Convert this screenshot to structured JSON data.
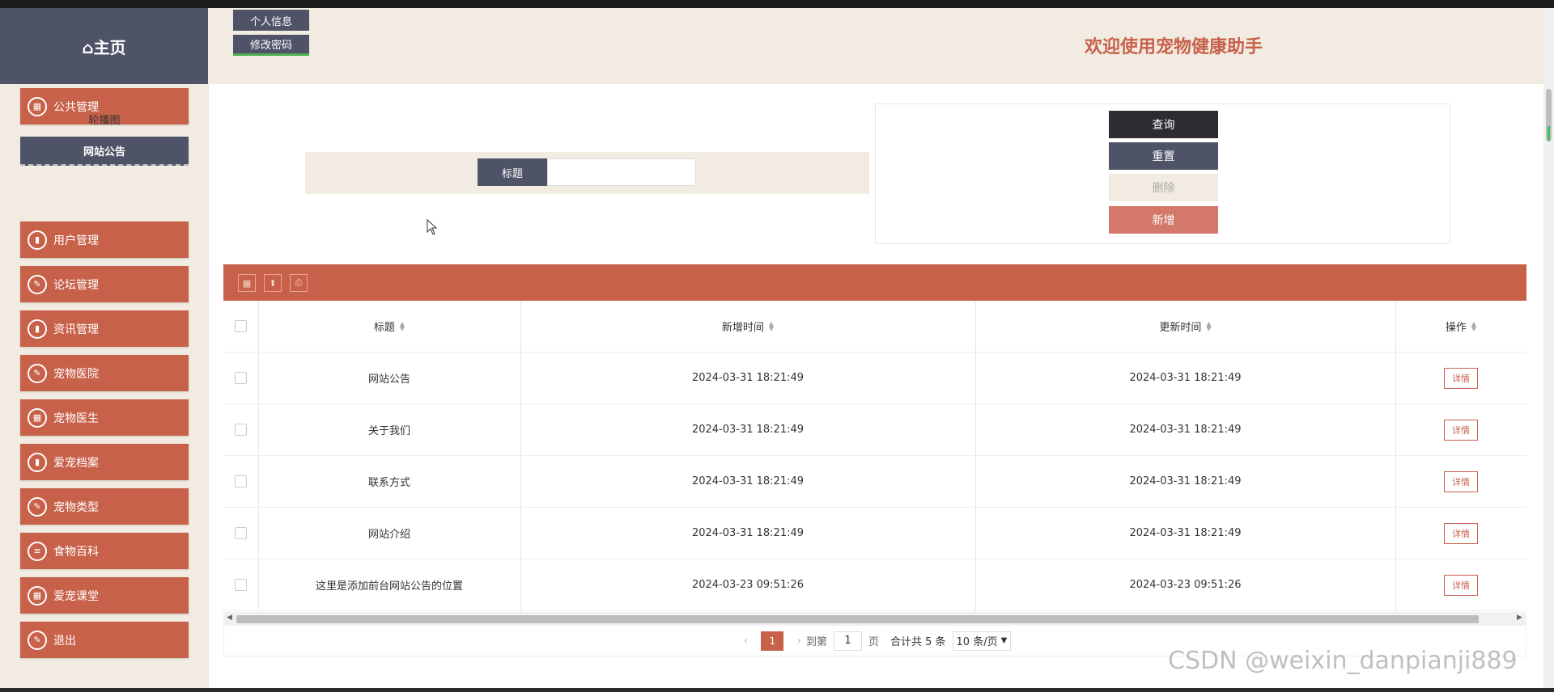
{
  "sidebar": {
    "logo": "⌂主页",
    "items": [
      {
        "label": "公共管理",
        "icon": "calendar-icon"
      },
      {
        "label": "用户管理",
        "icon": "chart-icon"
      },
      {
        "label": "论坛管理",
        "icon": "edit-icon"
      },
      {
        "label": "资讯管理",
        "icon": "chart-icon"
      },
      {
        "label": "宠物医院",
        "icon": "edit-icon"
      },
      {
        "label": "宠物医生",
        "icon": "calendar-icon"
      },
      {
        "label": "爱宠档案",
        "icon": "chart-icon"
      },
      {
        "label": "宠物类型",
        "icon": "edit-icon"
      },
      {
        "label": "食物百科",
        "icon": "clipboard-icon"
      },
      {
        "label": "爱宠课堂",
        "icon": "calendar-icon"
      },
      {
        "label": "退出",
        "icon": "edit-icon"
      }
    ],
    "subitems": [
      {
        "label": "轮播图"
      },
      {
        "label": "网站公告"
      }
    ]
  },
  "header": {
    "profile_btn": "个人信息",
    "password_btn": "修改密码",
    "welcome": "欢迎使用宠物健康助手"
  },
  "search": {
    "label": "标题",
    "value": ""
  },
  "actions": {
    "query": "查询",
    "reset": "重置",
    "delete": "删除",
    "add": "新增"
  },
  "table": {
    "columns": [
      "标题",
      "新增时间",
      "更新时间",
      "操作"
    ],
    "detail_label": "详情",
    "rows": [
      {
        "title": "网站公告",
        "created": "2024-03-31 18:21:49",
        "updated": "2024-03-31 18:21:49"
      },
      {
        "title": "关于我们",
        "created": "2024-03-31 18:21:49",
        "updated": "2024-03-31 18:21:49"
      },
      {
        "title": "联系方式",
        "created": "2024-03-31 18:21:49",
        "updated": "2024-03-31 18:21:49"
      },
      {
        "title": "网站介绍",
        "created": "2024-03-31 18:21:49",
        "updated": "2024-03-31 18:21:49"
      },
      {
        "title": "这里是添加前台网站公告的位置",
        "created": "2024-03-23 09:51:26",
        "updated": "2024-03-23 09:51:26"
      }
    ]
  },
  "pagination": {
    "current": "1",
    "goto_label": "到第",
    "goto_value": "1",
    "page_unit": "页",
    "total": "合计共 5 条",
    "page_size": "10 条/页"
  },
  "watermark": "CSDN @weixin_danpianji889",
  "colors": {
    "accent": "#c8614a",
    "dark": "#4e5368",
    "cream": "#f1ebe1"
  }
}
